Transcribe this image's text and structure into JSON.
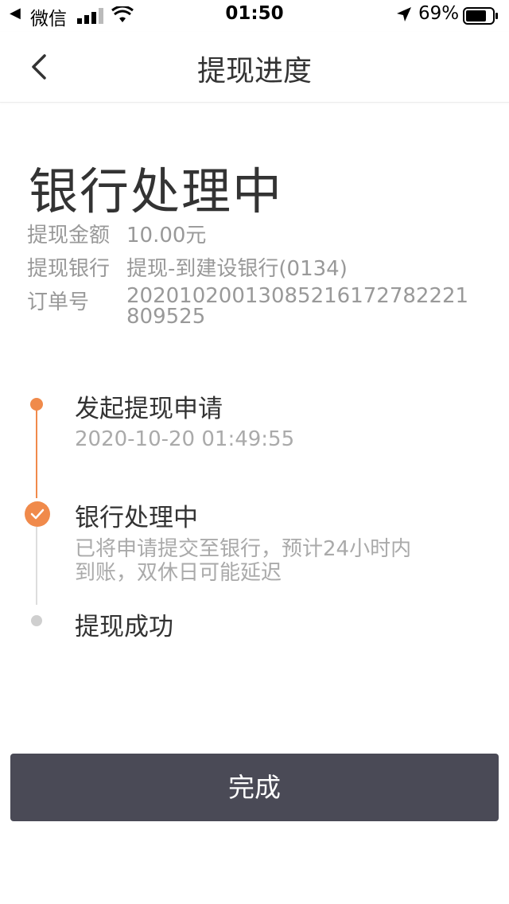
{
  "status_bar": {
    "back_app": "微信",
    "time": "01:50",
    "battery": "69%"
  },
  "nav": {
    "title": "提现进度"
  },
  "status_title": "银行处理中",
  "info": [
    {
      "label": "提现金额",
      "value": "10.00元"
    },
    {
      "label": "提现银行",
      "value": "提现-到建设银行(0134)"
    },
    {
      "label": "订单号",
      "value": "20201020013085216172782221809525"
    }
  ],
  "timeline": [
    {
      "title": "发起提现申请",
      "sub": "2020-10-20 01:49:55",
      "state": "done"
    },
    {
      "title": "银行处理中",
      "sub": "已将申请提交至银行，预计24小时内到账，双休日可能延迟",
      "state": "current"
    },
    {
      "title": "提现成功",
      "sub": "",
      "state": "pending"
    }
  ],
  "done_button": "完成",
  "colors": {
    "accent": "#f08a4b",
    "button_bg": "#4a4a56",
    "muted_text": "#999999",
    "pending_dot": "#cfcfcf"
  }
}
